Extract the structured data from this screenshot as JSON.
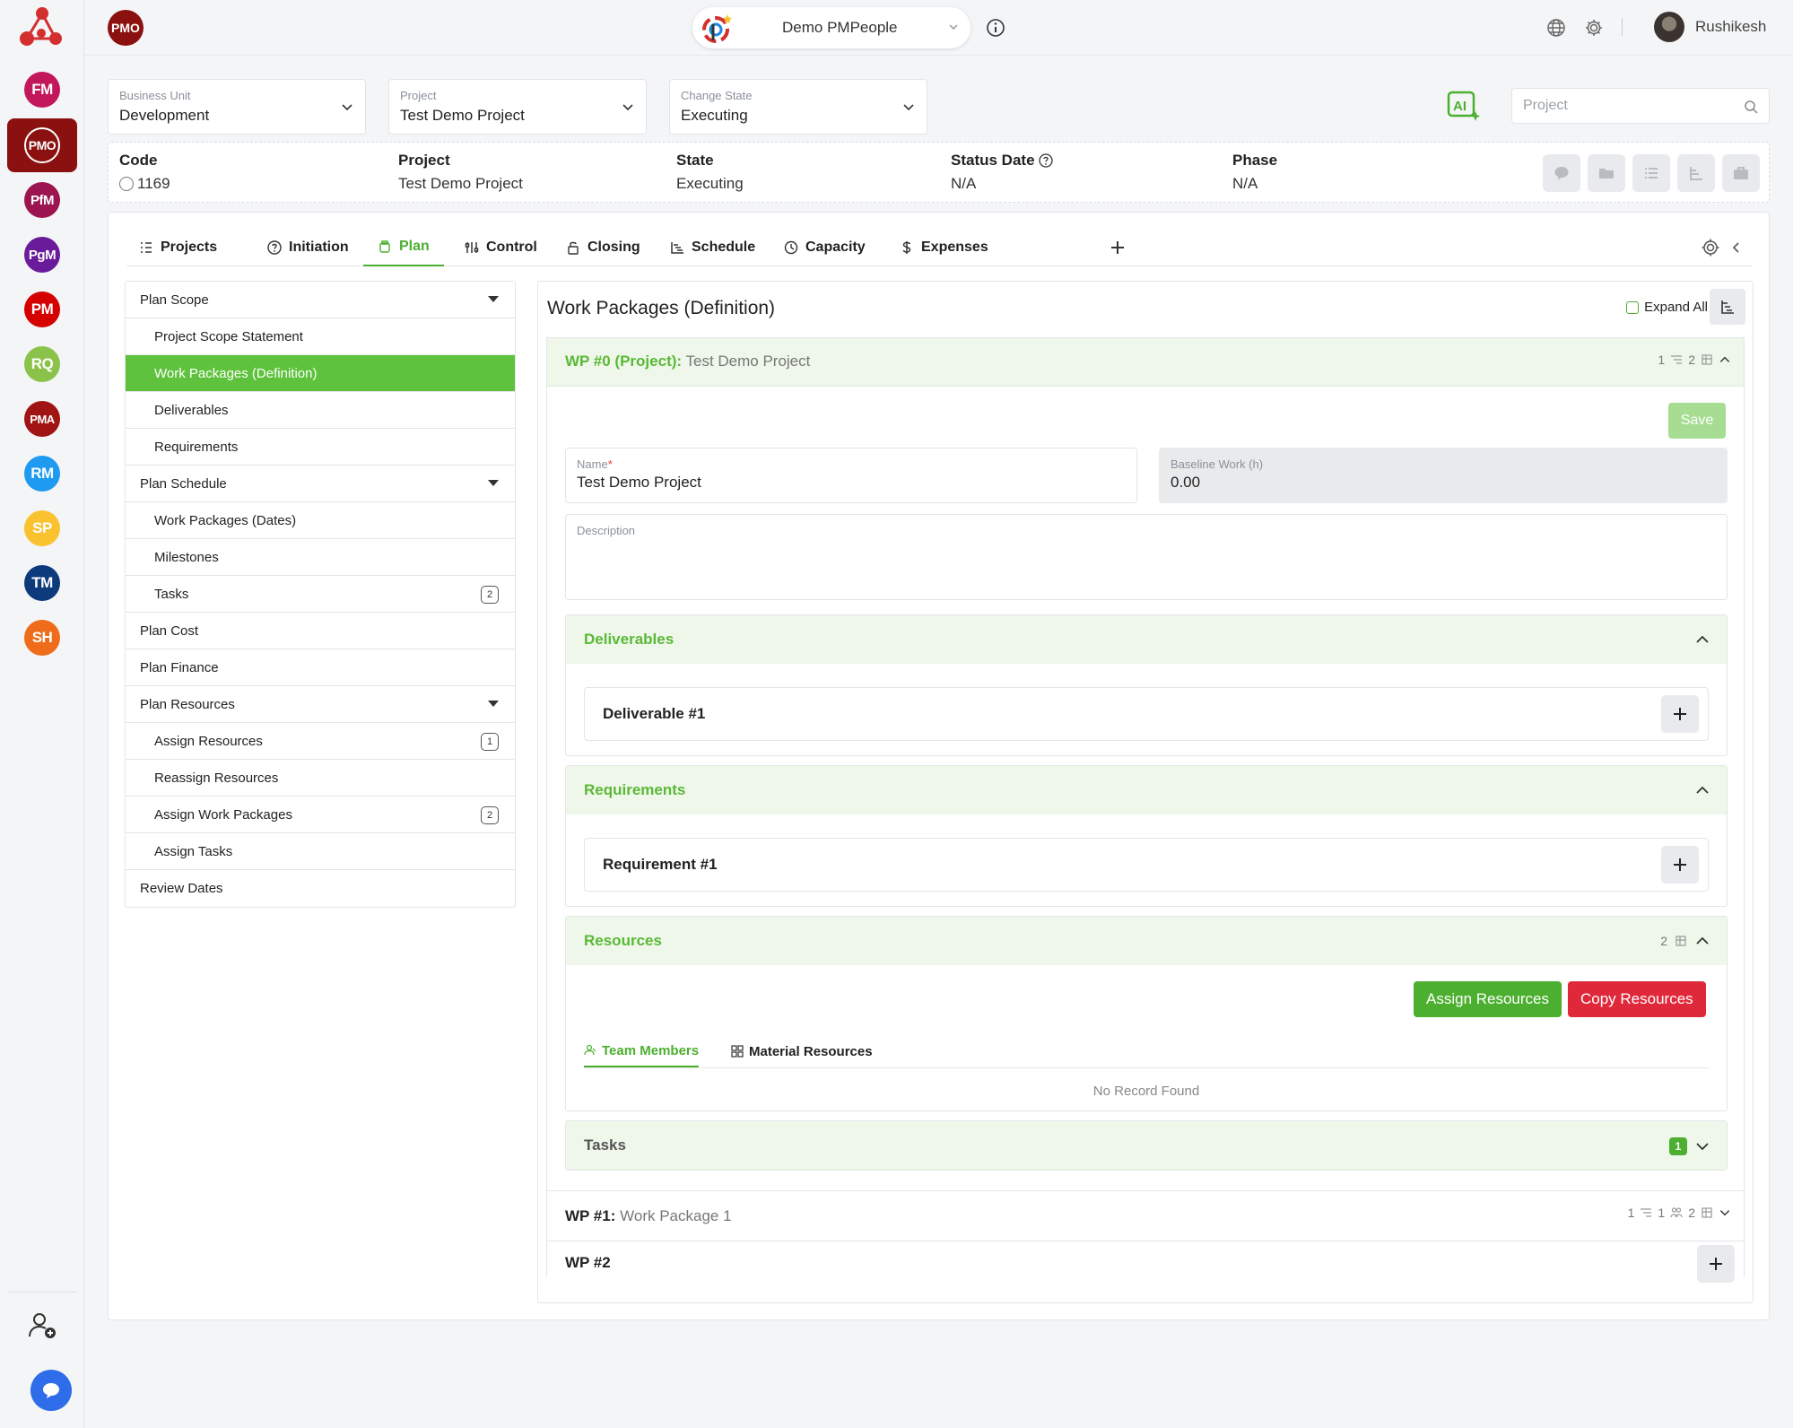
{
  "colors": {
    "accent": "#4caf2f",
    "brand": "#8b1110",
    "danger": "#e0283b",
    "section_bg": "#eef7ea"
  },
  "rail": {
    "items": [
      {
        "label": "FM",
        "color": "#c2185b"
      },
      {
        "label": "PMO",
        "color": "#8b1110"
      },
      {
        "label": "PfM",
        "color": "#9c1550"
      },
      {
        "label": "PgM",
        "color": "#6a1b9a"
      },
      {
        "label": "PM",
        "color": "#d50000"
      },
      {
        "label": "RQ",
        "color": "#8bc34a"
      },
      {
        "label": "PMA",
        "color": "#a01414"
      },
      {
        "label": "RM",
        "color": "#1e9bf0"
      },
      {
        "label": "SP",
        "color": "#f9c22e"
      },
      {
        "label": "TM",
        "color": "#0d3a7a"
      },
      {
        "label": "SH",
        "color": "#ef6c1a"
      }
    ]
  },
  "topbar": {
    "module_badge": "PMO",
    "org_name": "Demo PMPeople",
    "user_name": "Rushikesh"
  },
  "filters": {
    "business_unit": {
      "label": "Business Unit",
      "value": "Development"
    },
    "project": {
      "label": "Project",
      "value": "Test Demo Project"
    },
    "change_state": {
      "label": "Change State",
      "value": "Executing"
    },
    "ai_label": "AI",
    "search_placeholder": "Project"
  },
  "info": {
    "code": {
      "label": "Code",
      "value": "1169"
    },
    "project": {
      "label": "Project",
      "value": "Test Demo Project"
    },
    "state": {
      "label": "State",
      "value": "Executing"
    },
    "status_date": {
      "label": "Status Date",
      "value": "N/A"
    },
    "phase": {
      "label": "Phase",
      "value": "N/A"
    }
  },
  "tabs": [
    "Projects",
    "Initiation",
    "Plan",
    "Control",
    "Closing",
    "Schedule",
    "Capacity",
    "Expenses"
  ],
  "subnav": [
    {
      "label": "Plan Scope"
    },
    {
      "label": "Project Scope Statement"
    },
    {
      "label": "Work Packages (Definition)"
    },
    {
      "label": "Deliverables"
    },
    {
      "label": "Requirements"
    },
    {
      "label": "Plan Schedule"
    },
    {
      "label": "Work Packages (Dates)"
    },
    {
      "label": "Milestones"
    },
    {
      "label": "Tasks",
      "badge": "2"
    },
    {
      "label": "Plan Cost"
    },
    {
      "label": "Plan Finance"
    },
    {
      "label": "Plan Resources"
    },
    {
      "label": "Assign Resources",
      "badge": "1"
    },
    {
      "label": "Reassign Resources"
    },
    {
      "label": "Assign Work Packages",
      "badge": "2"
    },
    {
      "label": "Assign Tasks"
    },
    {
      "label": "Review Dates"
    }
  ],
  "content": {
    "title": "Work Packages (Definition)",
    "expand_all": "Expand All",
    "wp0": {
      "id_label": "WP #0 (Project)",
      "colon": ":",
      "name": "Test Demo Project",
      "meta_count_a": "1",
      "meta_count_b": "2",
      "save": "Save",
      "name_label": "Name",
      "required_mark": "*",
      "name_value": "Test Demo Project",
      "baseline_label": "Baseline Work (h)",
      "baseline_value": "0.00",
      "description_label": "Description",
      "deliverables": {
        "title": "Deliverables",
        "item": "Deliverable #1"
      },
      "requirements": {
        "title": "Requirements",
        "item": "Requirement #1"
      },
      "resources": {
        "title": "Resources",
        "count": "2",
        "assign_btn": "Assign Resources",
        "copy_btn": "Copy Resources",
        "tab_team": "Team Members",
        "tab_material": "Material Resources",
        "empty": "No Record Found"
      },
      "tasks": {
        "title": "Tasks",
        "badge": "1"
      }
    },
    "wp1": {
      "id_label": "WP #1",
      "colon": ":",
      "name": "Work Package 1",
      "meta_a": "1",
      "meta_b": "1",
      "meta_c": "2"
    },
    "wp2": {
      "id_label": "WP #2"
    }
  }
}
